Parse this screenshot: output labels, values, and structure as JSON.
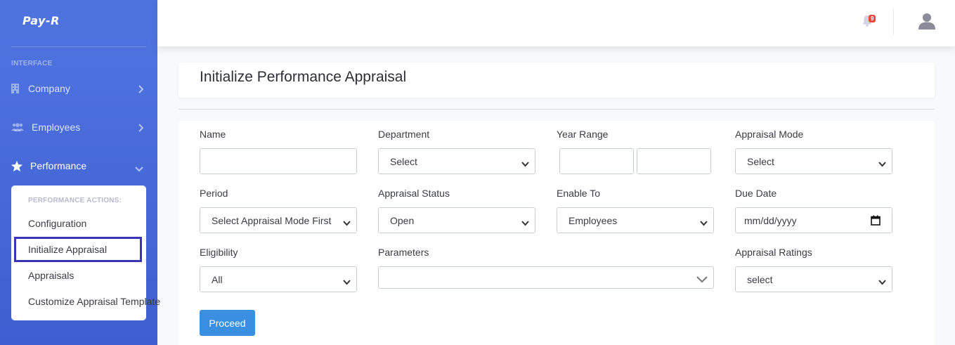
{
  "brand": "Pay-R",
  "sidebar": {
    "heading": "INTERFACE",
    "items": [
      {
        "label": "Company",
        "icon": "building-icon"
      },
      {
        "label": "Employees",
        "icon": "users-icon"
      },
      {
        "label": "Performance",
        "icon": "star-icon"
      }
    ],
    "performance_menu": {
      "header": "PERFORMANCE ACTIONS:",
      "items": [
        "Configuration",
        "Initialize Appraisal",
        "Appraisals",
        "Customize Appraisal Template"
      ]
    }
  },
  "topbar": {
    "notification_count": "9"
  },
  "page": {
    "title": "Initialize Performance Appraisal"
  },
  "form": {
    "name": {
      "label": "Name",
      "value": ""
    },
    "department": {
      "label": "Department",
      "value": "Select"
    },
    "year_range": {
      "label": "Year Range",
      "from": "",
      "to": ""
    },
    "appraisal_mode": {
      "label": "Appraisal Mode",
      "value": "Select"
    },
    "period": {
      "label": "Period",
      "value": "Select Appraisal Mode First"
    },
    "appraisal_status": {
      "label": "Appraisal Status",
      "value": "Open"
    },
    "enable_to": {
      "label": "Enable To",
      "value": "Employees"
    },
    "due_date": {
      "label": "Due Date",
      "value": "mm/dd/yyyy"
    },
    "eligibility": {
      "label": "Eligibility",
      "value": "All"
    },
    "parameters": {
      "label": "Parameters",
      "value": ""
    },
    "appraisal_ratings": {
      "label": "Appraisal Ratings",
      "value": "select"
    },
    "proceed_label": "Proceed"
  },
  "colors": {
    "sidebar": "#4e73df",
    "primary_button": "#3b8fe0",
    "highlight_border": "#3b35b5",
    "badge": "#e74a3b"
  }
}
